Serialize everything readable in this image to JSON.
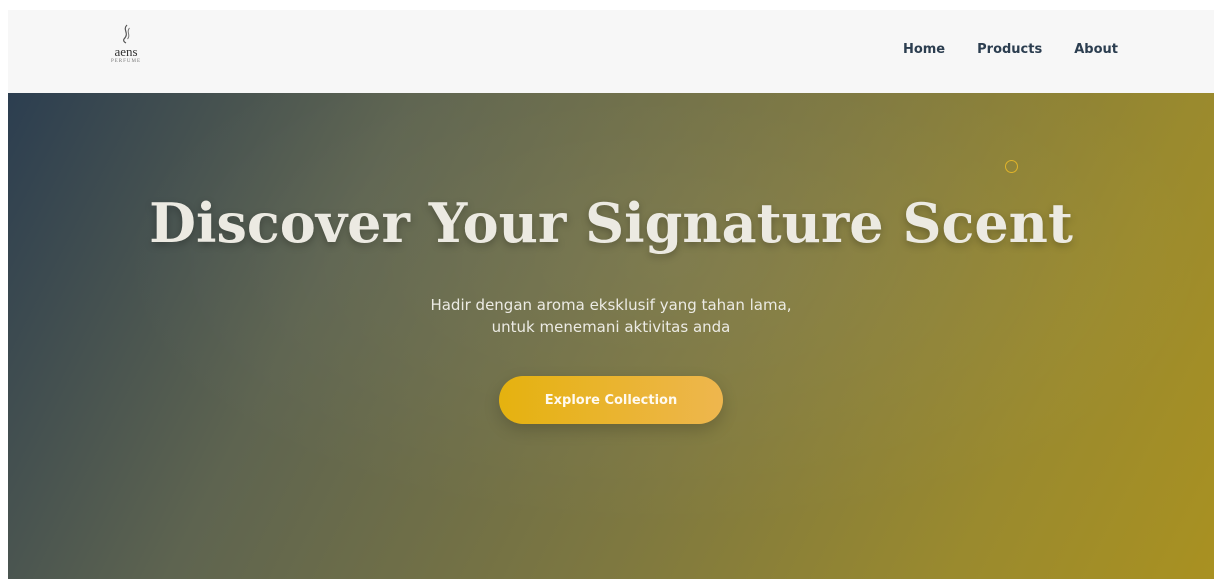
{
  "brand": {
    "name": "aens",
    "tagline": "PERFUME"
  },
  "nav": {
    "items": [
      {
        "label": "Home"
      },
      {
        "label": "Products"
      },
      {
        "label": "About"
      }
    ]
  },
  "hero": {
    "title": "Discover Your Signature Scent",
    "subtitle_line1": "Hadir dengan aroma eksklusif yang tahan lama,",
    "subtitle_line2": "untuk menemani aktivitas anda",
    "cta_label": "Explore Collection"
  },
  "colors": {
    "nav_text": "#2c3e50",
    "accent": "#e5b20f",
    "hero_start": "#2c3e50",
    "hero_end": "#a99121"
  },
  "icons": {
    "logo": "flame-swirl-icon",
    "decoration": "ring-icon"
  }
}
